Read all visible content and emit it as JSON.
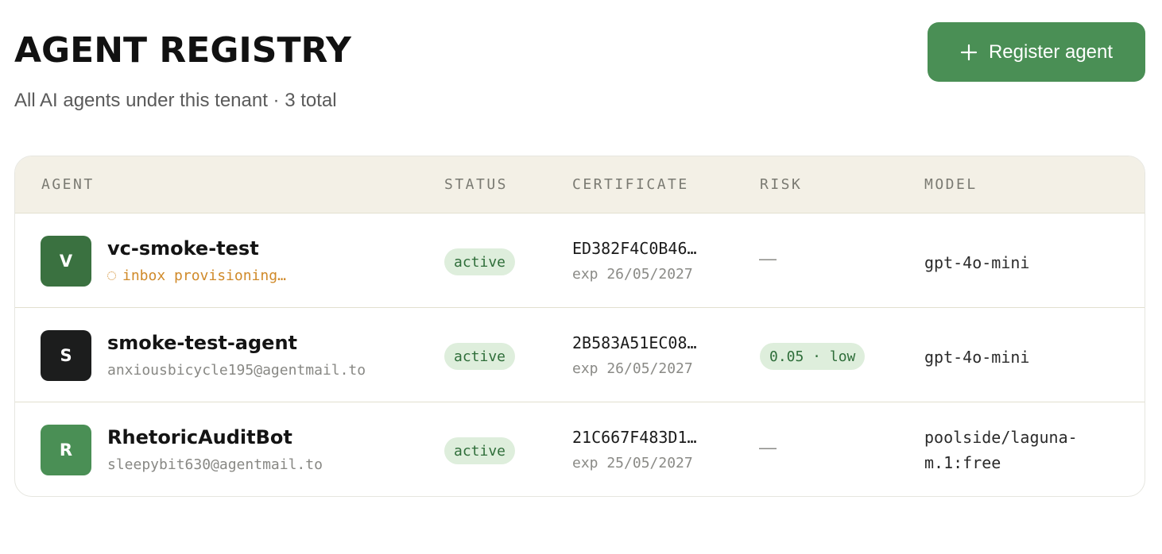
{
  "header": {
    "title": "AGENT REGISTRY",
    "subtitle": "All AI agents under this tenant · 3 total",
    "register_label": "Register agent",
    "register_icon": "plus-icon"
  },
  "table": {
    "columns": [
      "AGENT",
      "STATUS",
      "CERTIFICATE",
      "RISK",
      "MODEL"
    ],
    "rows": [
      {
        "initial": "V",
        "avatar_color": "#3a7140",
        "name": "vc-smoke-test",
        "sub": "inbox provisioning…",
        "status": "active",
        "cert_id": "ED382F4C0B46…",
        "cert_exp": "exp 26/05/2027",
        "risk": "—",
        "model": "gpt-4o-mini"
      },
      {
        "initial": "S",
        "avatar_color": "#1c1d1d",
        "name": "smoke-test-agent",
        "sub": "anxiousbicycle195@agentmail.to",
        "status": "active",
        "cert_id": "2B583A51EC08…",
        "cert_exp": "exp 26/05/2027",
        "risk": "0.05 · low",
        "model": "gpt-4o-mini"
      },
      {
        "initial": "R",
        "avatar_color": "#4a8f55",
        "name": "RhetoricAuditBot",
        "sub": "sleepybit630@agentmail.to",
        "status": "active",
        "cert_id": "21C667F483D1…",
        "cert_exp": "exp 25/05/2027",
        "risk": "—",
        "model": "poolside/laguna-m.1:free"
      }
    ]
  },
  "colors": {
    "accent": "#4a8f55",
    "badge_bg": "#deeedc",
    "badge_text": "#2f6e3a",
    "pending": "#d08a2a",
    "header_bg": "#f3f0e6"
  }
}
